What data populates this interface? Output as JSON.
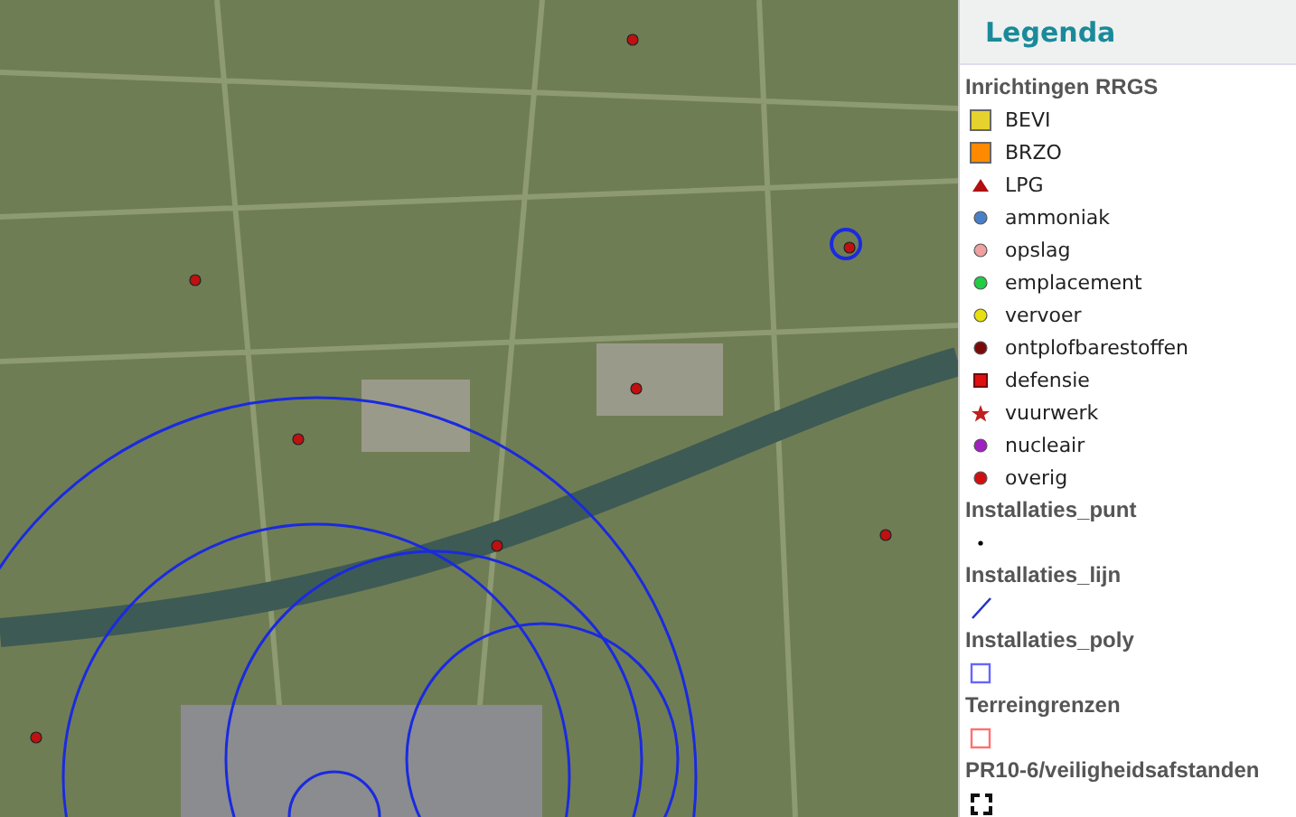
{
  "legend": {
    "title": "Legenda",
    "groups": [
      {
        "title": "Inrichtingen RRGS",
        "items": [
          {
            "label": "BEVI",
            "kind": "square",
            "color": "#e6d22e"
          },
          {
            "label": "BRZO",
            "kind": "square",
            "color": "#ff8a00"
          },
          {
            "label": "LPG",
            "kind": "triangle",
            "color": "#b01010"
          },
          {
            "label": "ammoniak",
            "kind": "circle",
            "color": "#4a7fc8"
          },
          {
            "label": "opslag",
            "kind": "circle",
            "color": "#f0a0a0"
          },
          {
            "label": "emplacement",
            "kind": "circle",
            "color": "#22cc44"
          },
          {
            "label": "vervoer",
            "kind": "circle",
            "color": "#e6e010"
          },
          {
            "label": "ontplofbarestoffen",
            "kind": "circle",
            "color": "#7a0a0a"
          },
          {
            "label": "defensie",
            "kind": "smallsquare",
            "color": "#e01010"
          },
          {
            "label": "vuurwerk",
            "kind": "star",
            "color": "#c02020"
          },
          {
            "label": "nucleair",
            "kind": "circle",
            "color": "#a020c0"
          },
          {
            "label": "overig",
            "kind": "circle",
            "color": "#d01010"
          }
        ]
      },
      {
        "title": "Installaties_punt",
        "items": [
          {
            "kind": "dot",
            "color": "#000000"
          }
        ]
      },
      {
        "title": "Installaties_lijn",
        "items": [
          {
            "kind": "line",
            "color": "#2233cc"
          }
        ]
      },
      {
        "title": "Installaties_poly",
        "items": [
          {
            "kind": "outline",
            "color": "#6666ff"
          }
        ]
      },
      {
        "title": "Terreingrenzen",
        "items": [
          {
            "kind": "outline",
            "color": "#ff7070"
          }
        ]
      },
      {
        "title": "PR10-6/veiligheidsafstanden",
        "items": [
          {
            "kind": "corners",
            "color": "#111111"
          }
        ]
      }
    ]
  }
}
